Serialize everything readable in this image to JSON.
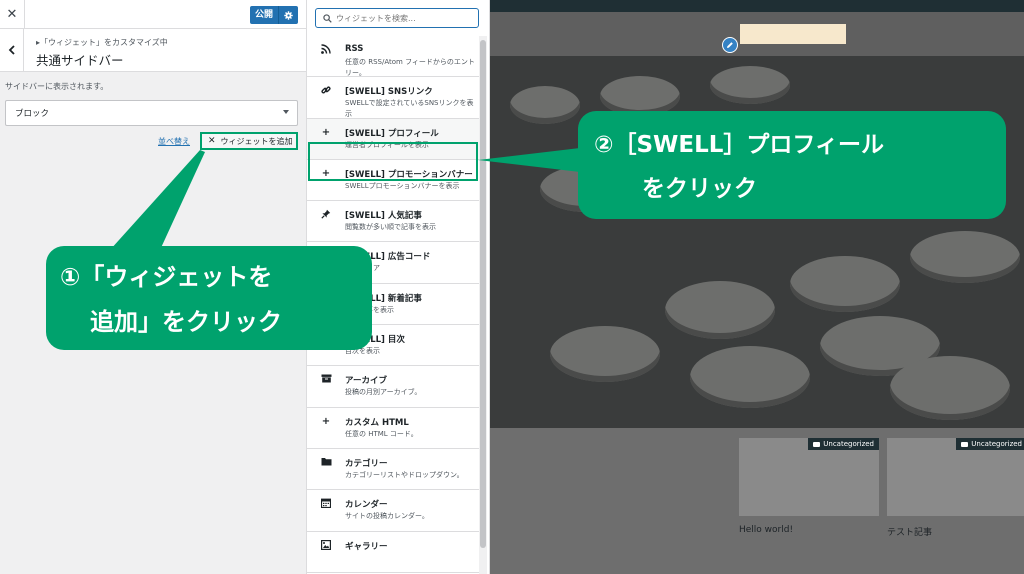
{
  "customizer": {
    "close_icon": "close-icon",
    "publish_label": "公開",
    "breadcrumb": "▸「ウィジェット」をカスタマイズ中",
    "section_title": "共通サイドバー",
    "description": "サイドバーに表示されます。",
    "block_select_value": "ブロック",
    "reorder_label": "並べ替え",
    "add_widget_label": "ウィジェットを追加"
  },
  "widgets": {
    "search_placeholder": "ウィジェットを検索...",
    "items": [
      {
        "title": "RSS",
        "desc": "任意の RSS/Atom フィードからのエントリー。",
        "icon": "rss-icon"
      },
      {
        "title": "[SWELL] SNSリンク",
        "desc": "SWELLで設定されているSNSリンクを表示",
        "icon": "link-icon"
      },
      {
        "title": "[SWELL] プロフィール",
        "desc": "運営者プロフィールを表示",
        "icon": "plus-icon"
      },
      {
        "title": "[SWELL] プロモーションバナー",
        "desc": "SWELLプロモーションバナーを表示",
        "icon": "plus-icon"
      },
      {
        "title": "[SWELL] 人気記事",
        "desc": "閲覧数が多い順で記事を表示",
        "icon": "pin-icon"
      },
      {
        "title": "[SWELL] 広告コード",
        "desc": "広告エリア",
        "icon": "plus-icon"
      },
      {
        "title": "[SWELL] 新着記事",
        "desc": "新着記事を表示",
        "icon": "plus-icon"
      },
      {
        "title": "[SWELL] 目次",
        "desc": "目次を表示",
        "icon": "plus-icon"
      },
      {
        "title": "アーカイブ",
        "desc": "投稿の月別アーカイブ。",
        "icon": "archive-icon"
      },
      {
        "title": "カスタム HTML",
        "desc": "任意の HTML コード。",
        "icon": "plus-icon"
      },
      {
        "title": "カテゴリー",
        "desc": "カテゴリーリストやドロップダウン。",
        "icon": "folder-icon"
      },
      {
        "title": "カレンダー",
        "desc": "サイトの投稿カレンダー。",
        "icon": "calendar-icon"
      },
      {
        "title": "ギャラリー",
        "desc": "",
        "icon": "gallery-icon"
      }
    ]
  },
  "preview": {
    "posts": [
      {
        "category": "Uncategorized",
        "title": "Hello world!"
      },
      {
        "category": "Uncategorized",
        "title": "テスト記事"
      }
    ]
  },
  "annotations": {
    "step1_line1": "①「ウィジェットを",
    "step1_line2": "追加」をクリック",
    "step2_line1": "②［SWELL］プロフィール",
    "step2_line2": "をクリック"
  },
  "colors": {
    "accent": "#00a26d",
    "wp_blue": "#2271b1"
  }
}
